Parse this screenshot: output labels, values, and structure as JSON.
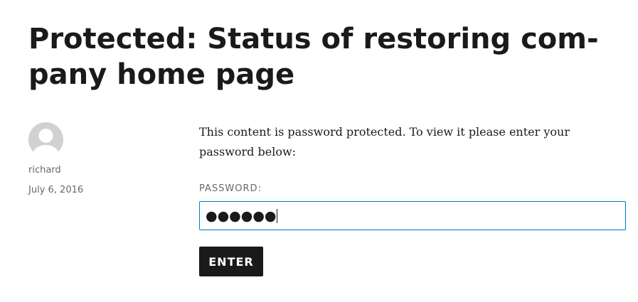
{
  "post": {
    "title_line_1": "Protected: Status of restoring com-",
    "title_line_2": "pany home page",
    "author": "richard",
    "date": "July 6, 2016"
  },
  "form": {
    "notice": "This content is password protected. To view it please enter your password below:",
    "password_label": "PASSWORD:",
    "password_value_masked": "●●●●●●",
    "submit_label": "ENTER"
  },
  "icons": {
    "avatar": "default-user-avatar-icon"
  },
  "colors": {
    "text": "#1a1a1a",
    "muted_text": "#686868",
    "input_focus_border": "#007acc",
    "button_background": "#1a1a1a",
    "button_text": "#ffffff",
    "avatar_background": "#d1d1d1"
  }
}
